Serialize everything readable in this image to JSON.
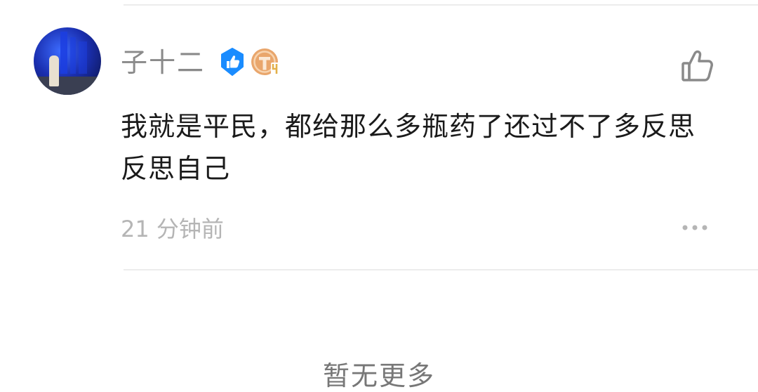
{
  "comment": {
    "username": "子十二",
    "content": "我就是平民，都给那么多瓶药了还过不了多反思反思自己",
    "time": "21 分钟前",
    "level_badge": {
      "letter": "T",
      "number": "4",
      "color": "#e8a46a"
    },
    "verified_badge_color": "#1a8cff"
  },
  "footer": {
    "no_more_text": "暂无更多"
  },
  "icons": {
    "like": "thumbs-up-icon",
    "more": "more-dots-icon",
    "verified": "verified-thumb-badge-icon",
    "level": "level-badge-icon"
  }
}
